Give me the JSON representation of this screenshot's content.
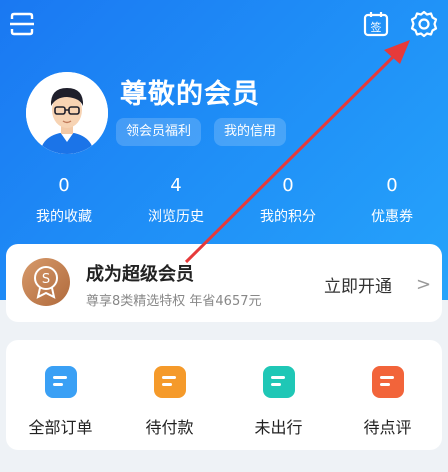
{
  "header": {
    "icons": [
      "scan-icon",
      "sign-in-icon",
      "settings-gear-icon"
    ],
    "sign_glyph": "签",
    "greeting": "尊敬的会员",
    "pills": [
      "领会员福利",
      "我的信用"
    ],
    "stats": [
      {
        "value": "0",
        "label": "我的收藏"
      },
      {
        "value": "4",
        "label": "浏览历史"
      },
      {
        "value": "0",
        "label": "我的积分"
      },
      {
        "value": "0",
        "label": "优惠券"
      }
    ],
    "colors": {
      "accent": "#1a78f2",
      "accent_light": "#26a4fb"
    }
  },
  "vip": {
    "title": "成为超级会员",
    "subtitle": "尊享8类精选特权 年省4657元",
    "cta": "立即开通",
    "chevron": ">",
    "badge_glyph": "S"
  },
  "orders": [
    {
      "label": "全部订单",
      "icon": "all-orders-icon",
      "color": "#3aa0f5"
    },
    {
      "label": "待付款",
      "icon": "wallet-icon",
      "color": "#f59a2a"
    },
    {
      "label": "未出行",
      "icon": "not-traveled-icon",
      "color": "#1fc7b6"
    },
    {
      "label": "待点评",
      "icon": "review-icon",
      "color": "#f2643a"
    }
  ],
  "annotation": {
    "color": "#e63a3a"
  }
}
